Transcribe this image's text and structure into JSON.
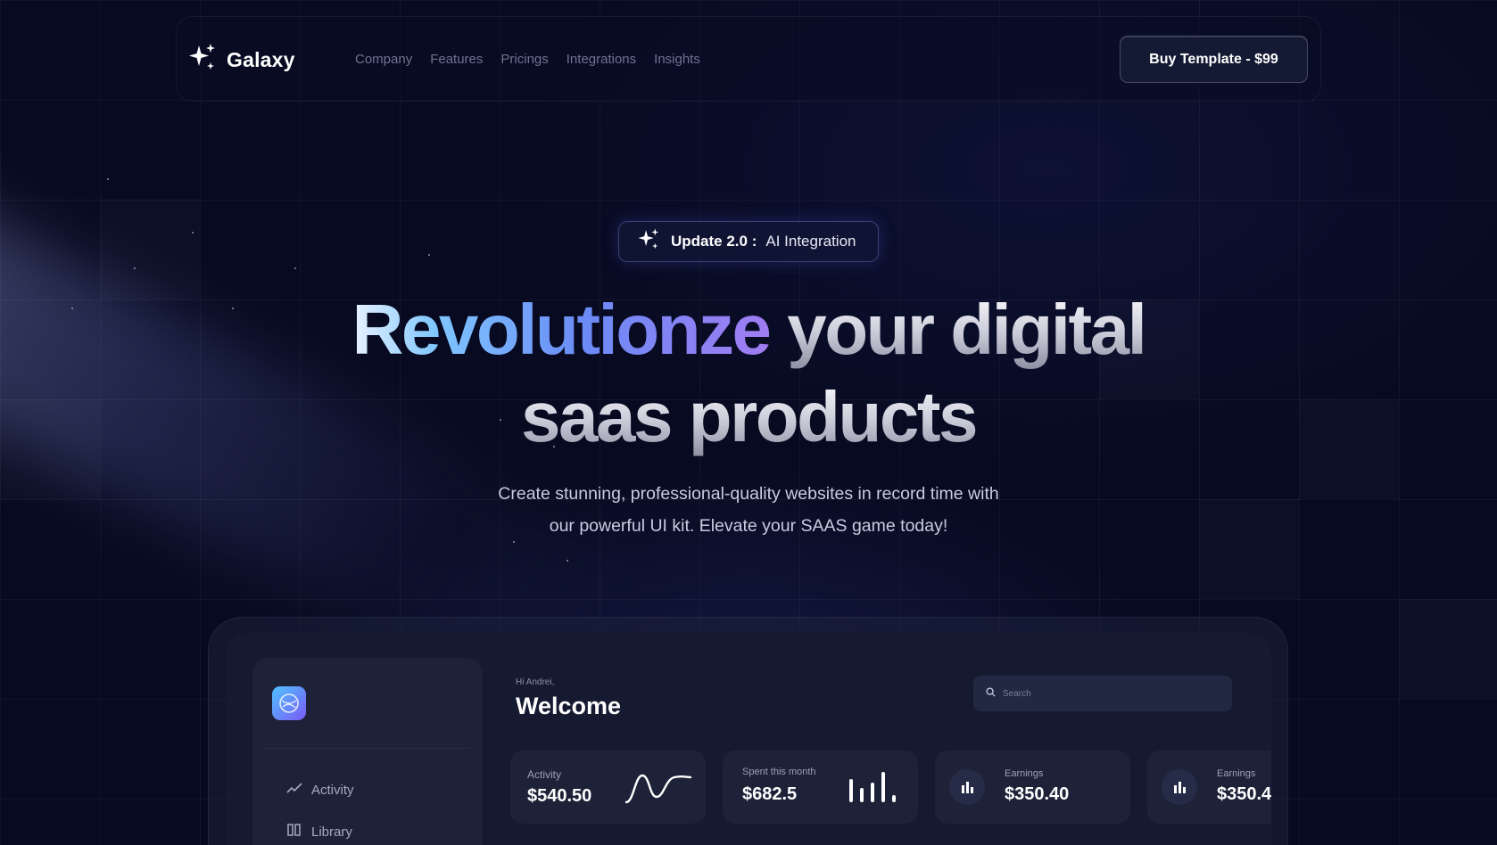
{
  "nav": {
    "logo_text": "Galaxy",
    "links": [
      "Company",
      "Features",
      "Pricings",
      "Integrations",
      "Insights"
    ],
    "cta_label": "Buy Template - $99"
  },
  "hero": {
    "badge_strong": "Update 2.0 :",
    "badge_text": "AI Integration",
    "headline_gradient": "Revolutionze",
    "headline_rest": "your digital",
    "headline_line2": "saas products",
    "subtitle_line1": "Create stunning, professional-quality websites in record time with",
    "subtitle_line2": "our powerful UI kit. Elevate your SAAS game today!"
  },
  "dashboard": {
    "greeting": "Hi Andrei,",
    "title": "Welcome",
    "search_placeholder": "Search",
    "sidebar_items": [
      {
        "label": "Activity",
        "icon": "activity-icon"
      },
      {
        "label": "Library",
        "icon": "library-icon"
      }
    ],
    "cards": [
      {
        "label": "Activity",
        "value": "$540.50",
        "icon": "wave-chart-icon"
      },
      {
        "label": "Spent this month",
        "value": "$682.5",
        "icon": "bar-chart-icon"
      },
      {
        "label": "Earnings",
        "value": "$350.40",
        "icon": "bar-chart-icon"
      },
      {
        "label": "Earnings",
        "value": "$350.4",
        "icon": "bar-chart-icon"
      }
    ]
  },
  "colors": {
    "background": "#070a20",
    "accent_gradient_start": "#7fc6ff",
    "accent_gradient_end": "#a07cf2",
    "panel": "#1d2238"
  }
}
